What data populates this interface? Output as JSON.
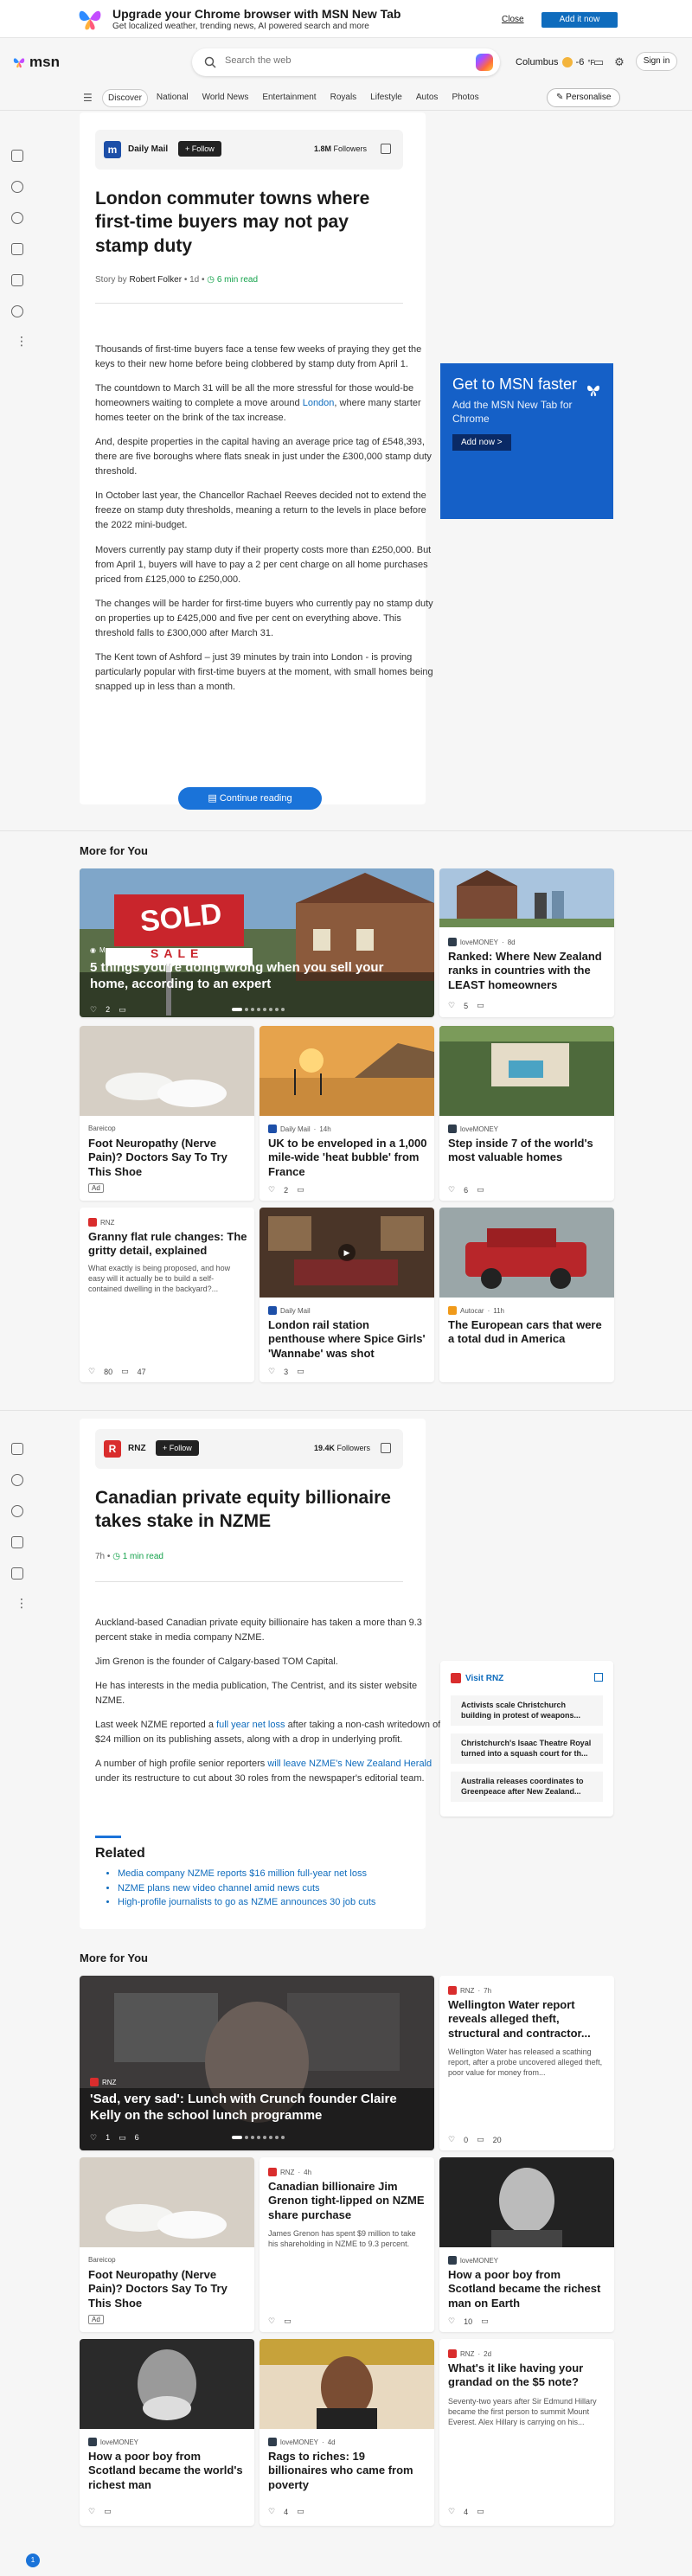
{
  "promo": {
    "title": "Upgrade your Chrome browser with MSN New Tab",
    "subtitle": "Get localized weather, trending news, AI powered search and more",
    "close_label": "Close",
    "add_label": "Add it now"
  },
  "topbar": {
    "logo_text": "msn",
    "search_placeholder": "Search the web",
    "weather_city": "Columbus",
    "weather_temp": "-6",
    "weather_unit": "°F",
    "signin_label": "Sign in"
  },
  "nav": {
    "items": [
      "Discover",
      "National",
      "World News",
      "Entertainment",
      "Royals",
      "Lifestyle",
      "Autos",
      "Photos"
    ],
    "personalise_label": "Personalise"
  },
  "article1": {
    "source_logo": "m",
    "source_name": "Daily Mail",
    "follow_label": "Follow",
    "followers_count": "1.8M",
    "followers_label": "Followers",
    "headline": "London commuter towns where first-time buyers may not pay stamp duty",
    "byline_prefix": "Story by",
    "author": "Robert Folker",
    "age": "1d",
    "read_time": "6 min read",
    "paragraphs": [
      "Thousands of first-time buyers face a tense few weeks of praying they get the keys to their new home before being clobbered by stamp duty from April 1.",
      "The countdown to March 31 will be all the more stressful for those would-be homeowners waiting to complete a move around",
      "And, despite properties in the capital having an average price tag of £548,393, there are five boroughs where flats sneak in just under the £300,000 stamp duty threshold.",
      "In October last year, the Chancellor Rachael Reeves decided not to extend the freeze on stamp duty thresholds, meaning a return to the levels in place before the 2022 mini-budget.",
      "Movers currently pay stamp duty if their property costs more than £250,000. But from April 1, buyers will have to pay a 2 per cent charge on all home purchases priced from £125,000 to £250,000.",
      "The changes will be harder for first-time buyers who currently pay no stamp duty on properties up to £425,000 and five per cent on everything above. This threshold falls to £300,000 after March 31.",
      "The Kent town of Ashford – just 39 minutes by train into London - is proving particularly popular with first-time buyers at the moment, with small homes being snapped up in less than a month."
    ],
    "p2_link": "London",
    "p2_tail": ", where many starter homes teeter on the brink of the tax increase.",
    "continue_label": "Continue reading"
  },
  "ad_msn": {
    "title": "Get to MSN faster",
    "body": "Add the MSN New Tab for Chrome",
    "button": "Add now >"
  },
  "more_for_you_1": {
    "title": "More for You",
    "hero": {
      "source": "Msn",
      "title": "5 things you're doing wrong when you sell your home, according to an expert",
      "sign": "SOLD",
      "sign_sub": "SALE",
      "likes": "2"
    },
    "cards": [
      {
        "source": "loveMONEY",
        "age": "8d",
        "title": "Ranked: Where New Zealand ranks in countries with the LEAST homeowners",
        "likes": "5"
      },
      {
        "source": "Bareicop",
        "title": "Foot Neuropathy (Nerve Pain)? Doctors Say To Try This Shoe",
        "ad": "Ad"
      },
      {
        "source": "Daily Mail",
        "age": "14h",
        "title": "UK to be enveloped in a 1,000 mile-wide 'heat bubble' from France",
        "likes": "2"
      },
      {
        "source": "loveMONEY",
        "title": "Step inside 7 of the world's most valuable homes",
        "likes": "6"
      },
      {
        "source": "RNZ",
        "title": "Granny flat rule changes: The gritty detail, explained",
        "desc": "What exactly is being proposed, and how easy will it actually be to build a self-contained dwelling in the backyard?...",
        "likes": "80",
        "comments": "47"
      },
      {
        "source": "Daily Mail",
        "title": "London rail station penthouse where Spice Girls' 'Wannabe' was shot",
        "likes": "3"
      },
      {
        "source": "Autocar",
        "age": "11h",
        "title": "The European cars that were a total dud in America"
      }
    ]
  },
  "article2": {
    "source_logo": "R",
    "source_name": "RNZ",
    "follow_label": "Follow",
    "followers_count": "19.4K",
    "followers_label": "Followers",
    "headline": "Canadian private equity billionaire takes stake in NZME",
    "age": "7h",
    "read_time": "1 min read",
    "p1": "Auckland-based Canadian private equity billionaire has taken a more than 9.3 percent stake in media company NZME.",
    "p2": "Jim Grenon is the founder of Calgary-based TOM Capital.",
    "p3": "He has interests in the media publication, The Centrist, and its sister website NZME.",
    "p4_pre": "Last week NZME reported a",
    "p4_link": "full year net loss",
    "p4_post": "after taking a non-cash writedown of $24 million on its publishing assets, along with a drop in underlying profit.",
    "p5_pre": "A number of high profile senior reporters",
    "p5_link": "will leave NZME's New Zealand Herald",
    "p5_post": "under its restructure to cut about 30 roles from the newspaper's editorial team.",
    "related_title": "Related",
    "related": [
      "Media company NZME reports $16 million full-year net loss",
      "NZME plans new video channel amid news cuts",
      "High-profile journalists to go as NZME announces 30 job cuts"
    ]
  },
  "visit_rnz": {
    "label": "Visit RNZ",
    "links": [
      "Activists scale Christchurch building in protest of weapons...",
      "Christchurch's Isaac Theatre Royal turned into a squash court for th...",
      "Australia releases coordinates to Greenpeace after New Zealand..."
    ]
  },
  "more_for_you_2": {
    "title": "More for You",
    "hero": {
      "source": "RNZ",
      "title": "'Sad, very sad': Lunch with Crunch founder Claire Kelly on the school lunch programme",
      "likes": "1",
      "comments": "6"
    },
    "cards": [
      {
        "source": "RNZ",
        "age": "7h",
        "title": "Wellington Water report reveals alleged theft, structural and contractor...",
        "desc": "Wellington Water has released a scathing report, after a probe uncovered alleged theft, poor value for money from...",
        "likes": "0",
        "comments": "20"
      },
      {
        "source": "Bareicop",
        "title": "Foot Neuropathy (Nerve Pain)? Doctors Say To Try This Shoe",
        "ad": "Ad"
      },
      {
        "source": "RNZ",
        "age": "4h",
        "title": "Canadian billionaire Jim Grenon tight-lipped on NZME share purchase",
        "desc": "James Grenon has spent $9 million to take his shareholding in NZME to 9.3 percent."
      },
      {
        "source": "loveMONEY",
        "title": "How a poor boy from Scotland became the richest man on Earth",
        "likes": "10"
      },
      {
        "source": "loveMONEY",
        "title": "How a poor boy from Scotland became the world's richest man"
      },
      {
        "source": "loveMONEY",
        "age": "4d",
        "title": "Rags to riches: 19 billionaires who came from poverty",
        "likes": "4"
      },
      {
        "source": "RNZ",
        "age": "2d",
        "title": "What's it like having your grandad on the $5 note?",
        "desc": "Seventy-two years after Sir Edmund Hillary became the first person to summit Mount Everest. Alex Hillary is carrying on his...",
        "likes": "4"
      }
    ]
  },
  "colors": {
    "accent": "#0f6cbd",
    "green": "#14a24b",
    "rnz_red": "#d92d2d"
  }
}
